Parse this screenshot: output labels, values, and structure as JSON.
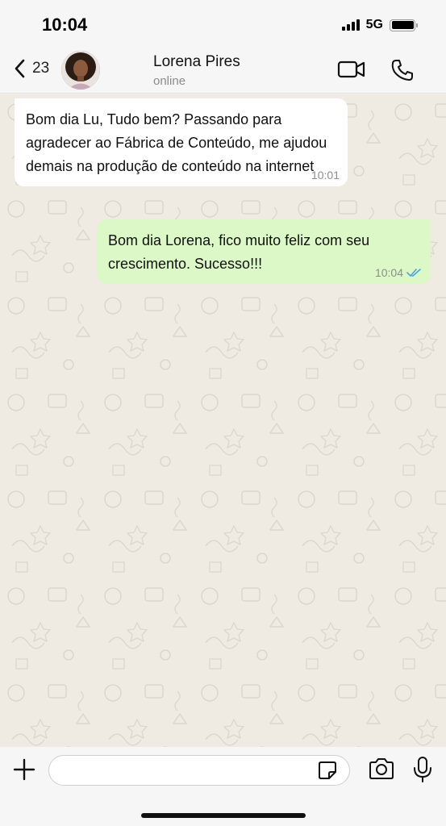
{
  "status_bar": {
    "time": "10:04",
    "network": "5G"
  },
  "header": {
    "back_count": "23",
    "contact_name": "Lorena Pires",
    "contact_status": "online",
    "icons": [
      "chevron-left-icon",
      "video-call-icon",
      "phone-icon"
    ]
  },
  "messages": [
    {
      "direction": "incoming",
      "text": "Bom dia Lu, Tudo bem? Passando para agradecer ao Fábrica de Conteúdo, me ajudou demais na produção de conteúdo na internet",
      "time": "10:01"
    },
    {
      "direction": "outgoing",
      "text": "Bom dia Lorena, fico muito feliz com seu crescimento. Sucesso!!!",
      "time": "10:04",
      "read": true
    }
  ],
  "composer": {
    "input_value": "",
    "icons": [
      "plus-icon",
      "sticker-icon",
      "camera-icon",
      "microphone-icon"
    ]
  },
  "colors": {
    "incoming_bubble": "#ffffff",
    "outgoing_bubble": "#dcf8c6",
    "read_ticks": "#4fa3e0",
    "chat_background": "#efeae2"
  }
}
